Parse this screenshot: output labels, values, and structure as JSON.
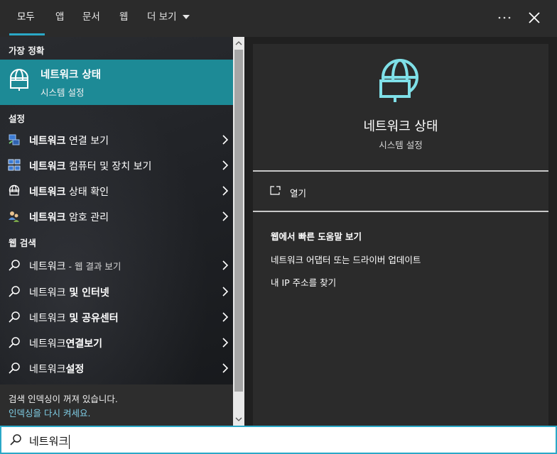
{
  "tabs": [
    {
      "label": "모두",
      "active": true
    },
    {
      "label": "앱"
    },
    {
      "label": "문서"
    },
    {
      "label": "웹"
    },
    {
      "label": "더 보기"
    }
  ],
  "topbar": {
    "more_icon": "ellipsis-icon",
    "close_icon": "close-icon"
  },
  "best_match": {
    "header": "가장 정확",
    "title": "네트워크 상태",
    "subtitle": "시스템 설정",
    "icon": "globe-monitor-icon"
  },
  "settings": {
    "header": "설정",
    "items": [
      {
        "bold": "네트워크",
        "rest": " 연결 보기",
        "icon": "network-connections-icon"
      },
      {
        "bold": "네트워크",
        "rest": " 컴퓨터 및 장치 보기",
        "icon": "network-computers-icon"
      },
      {
        "bold": "네트워크",
        "rest": " 상태 확인",
        "icon": "globe-icon"
      },
      {
        "bold": "네트워크",
        "rest": " 암호 관리",
        "icon": "users-key-icon"
      }
    ]
  },
  "web_search": {
    "header": "웹 검색",
    "items": [
      {
        "bold": "",
        "rest": "네트워크",
        "suffix": " - 웹 결과 보기"
      },
      {
        "bold": " 및 인터넷",
        "rest": "네트워크",
        "suffix": ""
      },
      {
        "bold": " 및 공유센터",
        "rest": "네트워크",
        "suffix": ""
      },
      {
        "bold": "연결보기",
        "rest": "네트워크",
        "suffix": ""
      },
      {
        "bold": "설정",
        "rest": "네트워크",
        "suffix": ""
      }
    ]
  },
  "index_notice": {
    "line1": "검색 인덱싱이 꺼져 있습니다.",
    "line2": "인덱싱을 다시 켜세요."
  },
  "preview": {
    "title": "네트워크 상태",
    "subtitle": "시스템 설정",
    "open_label": "열기",
    "help_title": "웹에서 빠른 도움말 보기",
    "help_links": [
      "네트워크 어댑터 또는 드라이버 업데이트",
      "내 IP 주소를 찾기"
    ]
  },
  "search": {
    "value": "네트워크"
  },
  "colors": {
    "accent": "#1d8a96",
    "focus": "#2aa8c7",
    "link": "#7fcde5"
  }
}
